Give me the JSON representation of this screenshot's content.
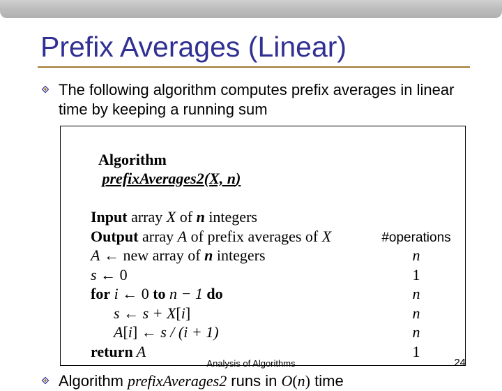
{
  "title": "Prefix Averages (Linear)",
  "bullets": {
    "b1": "The following algorithm computes prefix averages in linear time by keeping a running sum",
    "b2_pre": "Algorithm ",
    "b2_name": "prefixAverages2",
    "b2_post": " runs in ",
    "b2_order_o": "O",
    "b2_order_n": "n",
    "b2_tail": " time"
  },
  "algo": {
    "header_kw": "Algorithm",
    "header_name": "prefixAverages2",
    "header_args_open": "(",
    "header_args_x": "X, n",
    "header_args_close": ")",
    "input_kw": "Input",
    "input_rest_a": " array ",
    "input_rest_x": "X",
    "input_rest_b": " of ",
    "input_rest_n": "n",
    "input_rest_c": " integers",
    "output_kw": "Output",
    "output_a": " array ",
    "output_av": "A",
    "output_b": " of prefix averages of ",
    "output_xv": "X",
    "line4_a": "A",
    "line4_arrow": " ← ",
    "line4_b": "new array of ",
    "line4_n": "n",
    "line4_c": " integers",
    "line5_s": "s",
    "line5_arrow": " ← ",
    "line5_z": "0",
    "line6_for": "for",
    "line6_i": " i ",
    "line6_arrow": "← ",
    "line6_a": "0 ",
    "line6_to": "to",
    "line6_b": " n − 1 ",
    "line6_do": "do",
    "line7_s": "s ",
    "line7_arrow": "← ",
    "line7_rest": "s + X",
    "line7_idx_open": "[",
    "line7_idx_i": "i",
    "line7_idx_close": "]",
    "line8_a": "A",
    "line8_idx_open": "[",
    "line8_idx_i": "i",
    "line8_idx_close": "] ",
    "line8_arrow": "← ",
    "line8_rest": "s / (i + 1)",
    "line9_ret": "return",
    "line9_a": " A",
    "ops_header": "#operations",
    "ops": {
      "l4": "n",
      "l5": "1",
      "l6": "n",
      "l7": "n",
      "l8": "n",
      "l9": "1"
    }
  },
  "footer": "Analysis of Algorithms",
  "pagenum": "24"
}
